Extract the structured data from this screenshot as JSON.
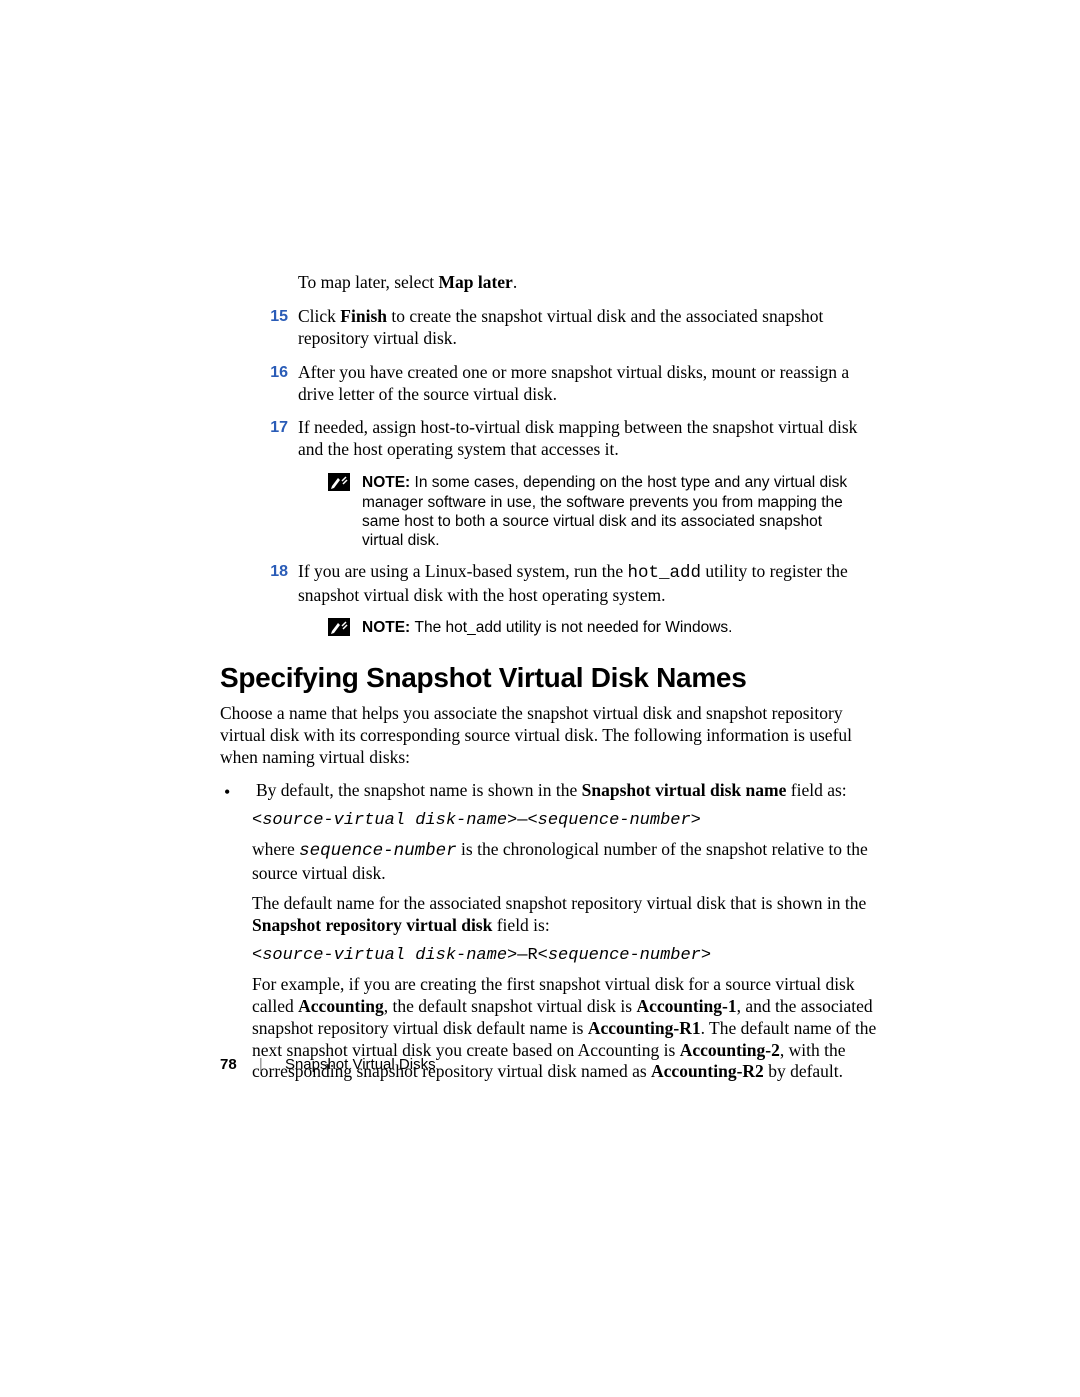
{
  "pre": "To map later, select ",
  "pre_bold": "Map later",
  "pre_tail": ".",
  "steps": {
    "15": {
      "a": "Click ",
      "b": "Finish",
      "c": " to create the snapshot virtual disk and the associated snapshot repository virtual disk."
    },
    "16": "After you have created one or more snapshot virtual disks, mount or reassign a drive letter of the source virtual disk.",
    "17": "If needed, assign host-to-virtual disk mapping between the snapshot virtual disk and the host operating system that accesses it.",
    "18": {
      "a": "If you are using a Linux-based system, run the ",
      "b": "hot_add",
      "c": " utility to register the snapshot virtual disk with the host operating system."
    }
  },
  "note_label": "NOTE: ",
  "note1": "In some cases, depending on the host type and any virtual disk manager software in use, the software prevents you from mapping the same host to both a source virtual disk and its associated snapshot virtual disk.",
  "note2": "The hot_add utility is not needed for Windows.",
  "h2": "Specifying Snapshot Virtual Disk Names",
  "intro": "Choose a name that helps you associate the snapshot virtual disk and snapshot repository virtual disk with its corresponding source virtual disk. The following information is useful when naming virtual disks:",
  "bullet1": {
    "a": "By default, the snapshot name is shown in the ",
    "b": "Snapshot virtual disk name",
    "c": " field as:"
  },
  "code1": {
    "a": "<source-virtual disk-name>",
    "b": "—",
    "c": "<sequence-number>"
  },
  "p_where": {
    "a": "where ",
    "b": "sequence-number",
    "c": " is the chronological number of the snapshot relative to the source virtual disk."
  },
  "p_default": {
    "a": "The default name for the associated snapshot repository virtual disk that is shown in the ",
    "b": "Snapshot repository virtual disk",
    "c": " field is:"
  },
  "code2": {
    "a": "<source-virtual disk-name>",
    "b": "—R",
    "c": "<sequence-number>"
  },
  "p_example": {
    "t1": "For example, if you are creating the first snapshot virtual disk for a source virtual disk called ",
    "b1": "Accounting",
    "t2": ", the default snapshot virtual disk is ",
    "b2": "Accounting-1",
    "t3": ", and the associated snapshot repository virtual disk default name is ",
    "b3": "Accounting-R1",
    "t4": ". The default name of the next snapshot virtual disk you create based on Accounting is ",
    "b4": "Accounting-2",
    "t5": ", with the corresponding snapshot repository virtual disk named as ",
    "b5": "Accounting-R2",
    "t6": " by default."
  },
  "footer": {
    "page": "78",
    "section": "Snapshot Virtual Disks"
  }
}
